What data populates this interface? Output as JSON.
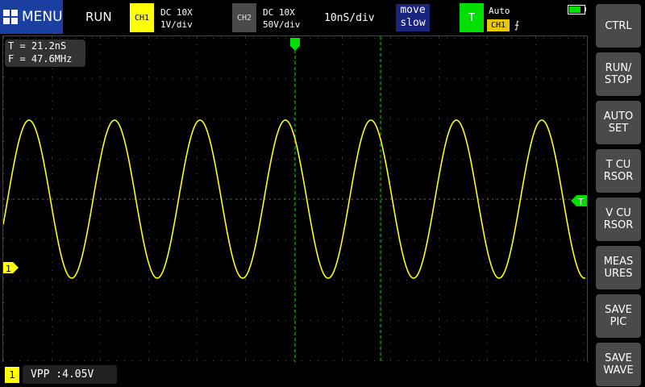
{
  "topbar": {
    "menu_label": "MENU",
    "run_status": "RUN",
    "ch1": {
      "badge": "CH1",
      "line1": "DC 10X",
      "line2": "1V/div",
      "color": "#ffff00"
    },
    "ch2": {
      "badge": "CH2",
      "line1": "DC 10X",
      "line2": "50V/div",
      "color": "#4a4a4a"
    },
    "timebase": "10nS/div",
    "move": {
      "line1": "move",
      "line2": "slow"
    },
    "trigger": {
      "badge": "T",
      "mode": "Auto",
      "source": "CH1",
      "edge": "⨍"
    },
    "battery_level": 0.8
  },
  "measurements": {
    "period": "T = 21.2nS",
    "frequency": "F = 47.6MHz"
  },
  "statusbar": {
    "channel": "1",
    "vpp": "VPP :4.05V"
  },
  "markers": {
    "trigger_level_label": "T",
    "channel_marker_label": "1"
  },
  "sidebar": [
    {
      "line1": "CTRL",
      "line2": ""
    },
    {
      "line1": "RUN/",
      "line2": "STOP"
    },
    {
      "line1": "AUTO",
      "line2": "SET"
    },
    {
      "line1": "T CU",
      "line2": "RSOR"
    },
    {
      "line1": "V CU",
      "line2": "RSOR"
    },
    {
      "line1": "MEAS",
      "line2": "URES"
    },
    {
      "line1": "SAVE",
      "line2": "PIC"
    },
    {
      "line1": "SAVE",
      "line2": "WAVE"
    }
  ],
  "colors": {
    "trace": "#ffff00",
    "trigger": "#00e000",
    "grid": "#4a4a4a",
    "menu": "#1a3fa0"
  }
}
